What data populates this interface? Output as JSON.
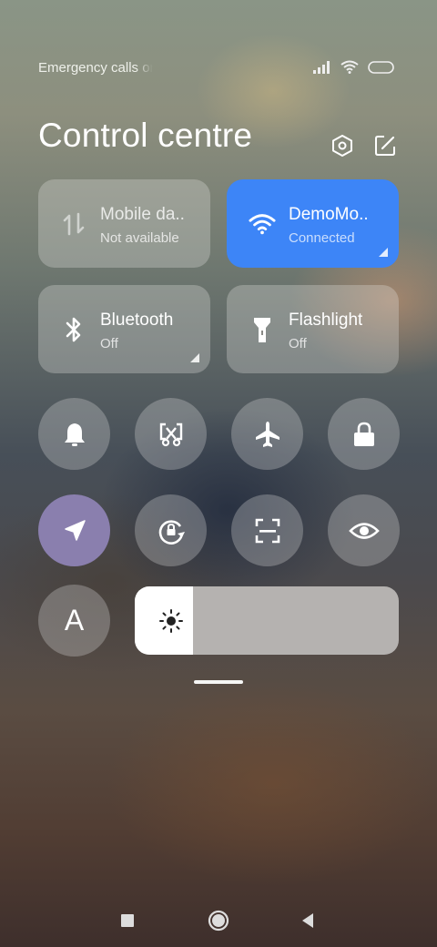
{
  "status_bar": {
    "carrier_text": "Emergency calls only",
    "icons": [
      "signal-icon",
      "wifi-icon",
      "battery-icon"
    ]
  },
  "header": {
    "title": "Control centre",
    "settings_icon": "hexagon-settings-icon",
    "edit_icon": "edit-icon"
  },
  "tiles": [
    {
      "label": "Mobile da..",
      "status": "Not available",
      "icon": "mobile-data-icon",
      "active": false
    },
    {
      "label": "DemoMo..",
      "status": "Connected",
      "icon": "wifi-icon",
      "active": true
    },
    {
      "label": "Bluetooth",
      "status": "Off",
      "icon": "bluetooth-icon",
      "active": false
    },
    {
      "label": "Flashlight",
      "status": "Off",
      "icon": "flashlight-icon",
      "active": false
    }
  ],
  "toggles_row1": [
    "bell-icon",
    "screenshot-icon",
    "airplane-icon",
    "lock-icon"
  ],
  "toggles_row2": [
    "location-icon",
    "rotation-lock-icon",
    "scan-icon",
    "reading-mode-icon"
  ],
  "font_toggle": {
    "label": "A"
  },
  "brightness": {
    "level": 0.22,
    "icon": "sun-icon"
  },
  "nav": [
    "recents-icon",
    "home-icon",
    "back-icon"
  ],
  "colors": {
    "active_tile": "#3d85f7",
    "location_active": "#8a7fae"
  }
}
